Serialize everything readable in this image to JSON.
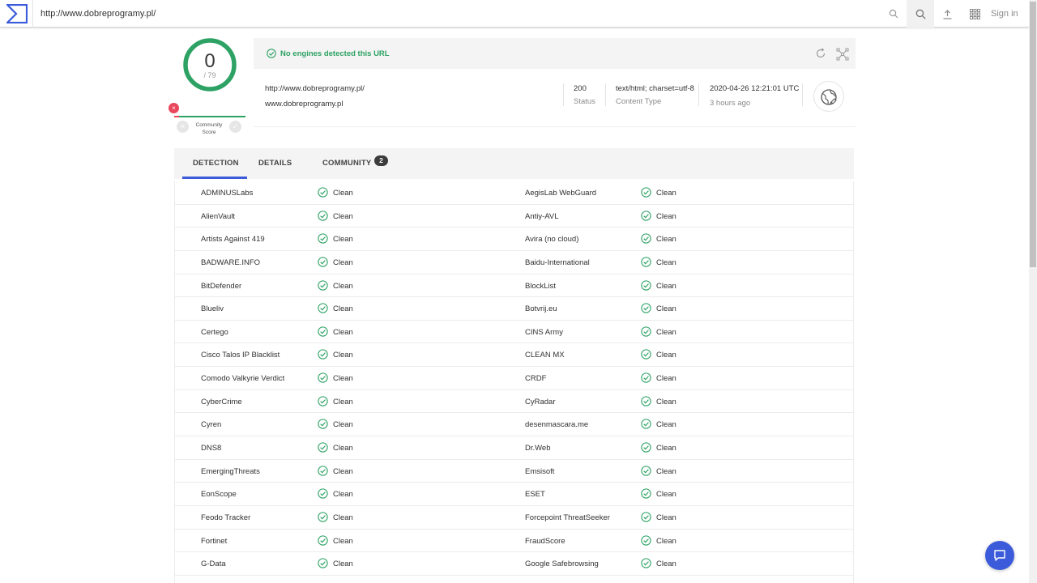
{
  "search": {
    "value": "http://www.dobreprogramy.pl/"
  },
  "header": {
    "signin_label": "Sign in"
  },
  "score": {
    "detections": "0",
    "total": "/ 79"
  },
  "community": {
    "label_line1": "Community",
    "label_line2": "Score"
  },
  "summary": {
    "message": "No engines detected this URL"
  },
  "info": {
    "url": "http://www.dobreprogramy.pl/",
    "domain": "www.dobreprogramy.pl",
    "status_value": "200",
    "status_label": "Status",
    "content_type_value": "text/html; charset=utf-8",
    "content_type_label": "Content Type",
    "date_value": "2020-04-26 12:21:01 UTC",
    "date_sub": "3 hours ago"
  },
  "tabs": {
    "detection": "DETECTION",
    "details": "DETAILS",
    "community": "COMMUNITY",
    "community_count": "2"
  },
  "colors": {
    "clean": "#2da264",
    "accent": "#3b5bdb",
    "malicious": "#e9475c"
  },
  "detections": [
    {
      "left": "ADMINUSLabs",
      "left_result": "Clean",
      "right": "AegisLab WebGuard",
      "right_result": "Clean"
    },
    {
      "left": "AlienVault",
      "left_result": "Clean",
      "right": "Antiy-AVL",
      "right_result": "Clean"
    },
    {
      "left": "Artists Against 419",
      "left_result": "Clean",
      "right": "Avira (no cloud)",
      "right_result": "Clean"
    },
    {
      "left": "BADWARE.INFO",
      "left_result": "Clean",
      "right": "Baidu-International",
      "right_result": "Clean"
    },
    {
      "left": "BitDefender",
      "left_result": "Clean",
      "right": "BlockList",
      "right_result": "Clean"
    },
    {
      "left": "Blueliv",
      "left_result": "Clean",
      "right": "Botvrij.eu",
      "right_result": "Clean"
    },
    {
      "left": "Certego",
      "left_result": "Clean",
      "right": "CINS Army",
      "right_result": "Clean"
    },
    {
      "left": "Cisco Talos IP Blacklist",
      "left_result": "Clean",
      "right": "CLEAN MX",
      "right_result": "Clean"
    },
    {
      "left": "Comodo Valkyrie Verdict",
      "left_result": "Clean",
      "right": "CRDF",
      "right_result": "Clean"
    },
    {
      "left": "CyberCrime",
      "left_result": "Clean",
      "right": "CyRadar",
      "right_result": "Clean"
    },
    {
      "left": "Cyren",
      "left_result": "Clean",
      "right": "desenmascara.me",
      "right_result": "Clean"
    },
    {
      "left": "DNS8",
      "left_result": "Clean",
      "right": "Dr.Web",
      "right_result": "Clean"
    },
    {
      "left": "EmergingThreats",
      "left_result": "Clean",
      "right": "Emsisoft",
      "right_result": "Clean"
    },
    {
      "left": "EonScope",
      "left_result": "Clean",
      "right": "ESET",
      "right_result": "Clean"
    },
    {
      "left": "Feodo Tracker",
      "left_result": "Clean",
      "right": "Forcepoint ThreatSeeker",
      "right_result": "Clean"
    },
    {
      "left": "Fortinet",
      "left_result": "Clean",
      "right": "FraudScore",
      "right_result": "Clean"
    },
    {
      "left": "G-Data",
      "left_result": "Clean",
      "right": "Google Safebrowsing",
      "right_result": "Clean"
    },
    {
      "left": "",
      "left_result": "",
      "right": "",
      "right_result": ""
    }
  ]
}
